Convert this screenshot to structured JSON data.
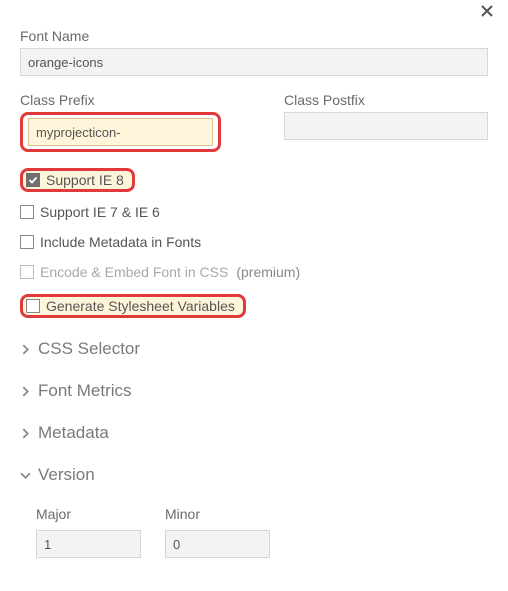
{
  "header": {
    "close_name": "close-icon"
  },
  "fontName": {
    "label": "Font Name",
    "value": "orange-icons"
  },
  "classPrefix": {
    "label": "Class Prefix",
    "value": "myprojecticon-"
  },
  "classPostfix": {
    "label": "Class Postfix",
    "value": ""
  },
  "checks": {
    "ie8": {
      "label": "Support IE 8",
      "checked": true
    },
    "ie76": {
      "label": "Support IE 7 & IE 6",
      "checked": false
    },
    "metadata": {
      "label": "Include Metadata in Fonts",
      "checked": false
    },
    "encode": {
      "label": "Encode & Embed Font in CSS",
      "checked": false,
      "suffix": "(premium)"
    },
    "vars": {
      "label": "Generate Stylesheet Variables",
      "checked": false
    }
  },
  "sections": {
    "cssSelector": "CSS Selector",
    "fontMetrics": "Font Metrics",
    "metadata": "Metadata",
    "version": "Version"
  },
  "version": {
    "major": {
      "label": "Major",
      "value": "1"
    },
    "minor": {
      "label": "Minor",
      "value": "0"
    }
  }
}
